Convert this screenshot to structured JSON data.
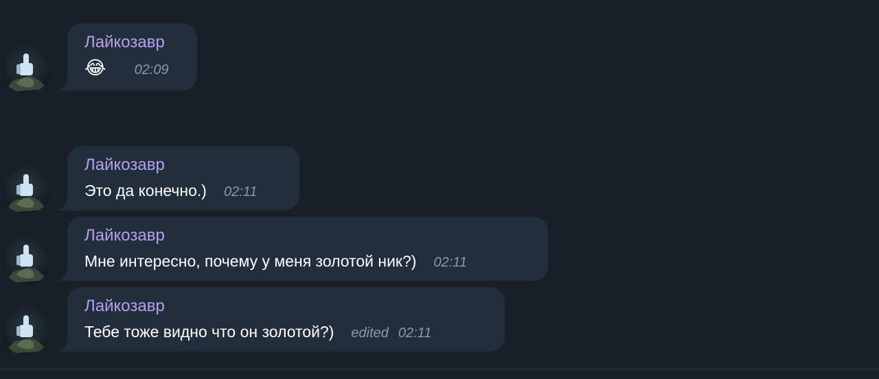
{
  "messages": [
    {
      "author": "Лайкозавр",
      "text": "😂",
      "time": "02:09",
      "edited": ""
    },
    {
      "author": "Лайкозавр",
      "text": "Это да конечно.)",
      "time": "02:11",
      "edited": ""
    },
    {
      "author": "Лайкозавр",
      "text": "Мне интересно, почему у меня золотой ник?)",
      "time": "02:11",
      "edited": ""
    },
    {
      "author": "Лайкозавр",
      "text": "Тебе тоже видно что он золотой?)",
      "time": "02:11",
      "edited": "edited"
    }
  ],
  "colors": {
    "background": "#1a2028",
    "bubble": "#232e3d",
    "author": "#b6a0ee",
    "text": "#ffffff",
    "meta": "#8d98a8"
  }
}
